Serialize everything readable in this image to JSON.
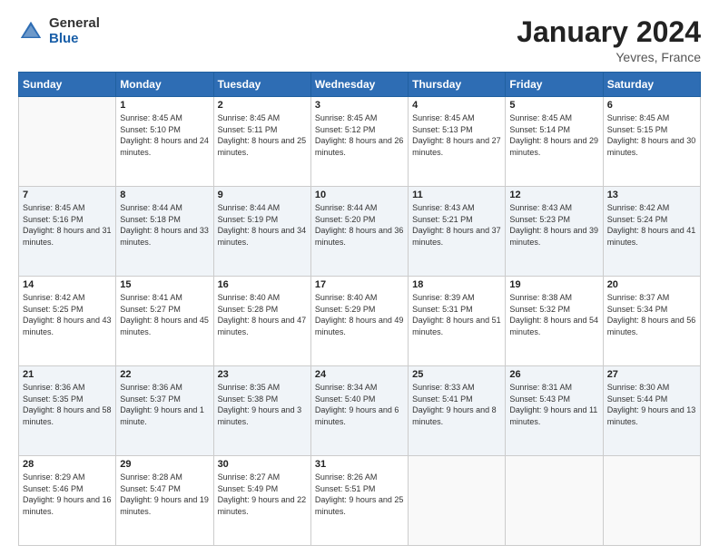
{
  "header": {
    "logo_general": "General",
    "logo_blue": "Blue",
    "month_title": "January 2024",
    "location": "Yevres, France"
  },
  "days_of_week": [
    "Sunday",
    "Monday",
    "Tuesday",
    "Wednesday",
    "Thursday",
    "Friday",
    "Saturday"
  ],
  "weeks": [
    [
      {
        "day": "",
        "sunrise": "",
        "sunset": "",
        "daylight": ""
      },
      {
        "day": "1",
        "sunrise": "Sunrise: 8:45 AM",
        "sunset": "Sunset: 5:10 PM",
        "daylight": "Daylight: 8 hours and 24 minutes."
      },
      {
        "day": "2",
        "sunrise": "Sunrise: 8:45 AM",
        "sunset": "Sunset: 5:11 PM",
        "daylight": "Daylight: 8 hours and 25 minutes."
      },
      {
        "day": "3",
        "sunrise": "Sunrise: 8:45 AM",
        "sunset": "Sunset: 5:12 PM",
        "daylight": "Daylight: 8 hours and 26 minutes."
      },
      {
        "day": "4",
        "sunrise": "Sunrise: 8:45 AM",
        "sunset": "Sunset: 5:13 PM",
        "daylight": "Daylight: 8 hours and 27 minutes."
      },
      {
        "day": "5",
        "sunrise": "Sunrise: 8:45 AM",
        "sunset": "Sunset: 5:14 PM",
        "daylight": "Daylight: 8 hours and 29 minutes."
      },
      {
        "day": "6",
        "sunrise": "Sunrise: 8:45 AM",
        "sunset": "Sunset: 5:15 PM",
        "daylight": "Daylight: 8 hours and 30 minutes."
      }
    ],
    [
      {
        "day": "7",
        "sunrise": "Sunrise: 8:45 AM",
        "sunset": "Sunset: 5:16 PM",
        "daylight": "Daylight: 8 hours and 31 minutes."
      },
      {
        "day": "8",
        "sunrise": "Sunrise: 8:44 AM",
        "sunset": "Sunset: 5:18 PM",
        "daylight": "Daylight: 8 hours and 33 minutes."
      },
      {
        "day": "9",
        "sunrise": "Sunrise: 8:44 AM",
        "sunset": "Sunset: 5:19 PM",
        "daylight": "Daylight: 8 hours and 34 minutes."
      },
      {
        "day": "10",
        "sunrise": "Sunrise: 8:44 AM",
        "sunset": "Sunset: 5:20 PM",
        "daylight": "Daylight: 8 hours and 36 minutes."
      },
      {
        "day": "11",
        "sunrise": "Sunrise: 8:43 AM",
        "sunset": "Sunset: 5:21 PM",
        "daylight": "Daylight: 8 hours and 37 minutes."
      },
      {
        "day": "12",
        "sunrise": "Sunrise: 8:43 AM",
        "sunset": "Sunset: 5:23 PM",
        "daylight": "Daylight: 8 hours and 39 minutes."
      },
      {
        "day": "13",
        "sunrise": "Sunrise: 8:42 AM",
        "sunset": "Sunset: 5:24 PM",
        "daylight": "Daylight: 8 hours and 41 minutes."
      }
    ],
    [
      {
        "day": "14",
        "sunrise": "Sunrise: 8:42 AM",
        "sunset": "Sunset: 5:25 PM",
        "daylight": "Daylight: 8 hours and 43 minutes."
      },
      {
        "day": "15",
        "sunrise": "Sunrise: 8:41 AM",
        "sunset": "Sunset: 5:27 PM",
        "daylight": "Daylight: 8 hours and 45 minutes."
      },
      {
        "day": "16",
        "sunrise": "Sunrise: 8:40 AM",
        "sunset": "Sunset: 5:28 PM",
        "daylight": "Daylight: 8 hours and 47 minutes."
      },
      {
        "day": "17",
        "sunrise": "Sunrise: 8:40 AM",
        "sunset": "Sunset: 5:29 PM",
        "daylight": "Daylight: 8 hours and 49 minutes."
      },
      {
        "day": "18",
        "sunrise": "Sunrise: 8:39 AM",
        "sunset": "Sunset: 5:31 PM",
        "daylight": "Daylight: 8 hours and 51 minutes."
      },
      {
        "day": "19",
        "sunrise": "Sunrise: 8:38 AM",
        "sunset": "Sunset: 5:32 PM",
        "daylight": "Daylight: 8 hours and 54 minutes."
      },
      {
        "day": "20",
        "sunrise": "Sunrise: 8:37 AM",
        "sunset": "Sunset: 5:34 PM",
        "daylight": "Daylight: 8 hours and 56 minutes."
      }
    ],
    [
      {
        "day": "21",
        "sunrise": "Sunrise: 8:36 AM",
        "sunset": "Sunset: 5:35 PM",
        "daylight": "Daylight: 8 hours and 58 minutes."
      },
      {
        "day": "22",
        "sunrise": "Sunrise: 8:36 AM",
        "sunset": "Sunset: 5:37 PM",
        "daylight": "Daylight: 9 hours and 1 minute."
      },
      {
        "day": "23",
        "sunrise": "Sunrise: 8:35 AM",
        "sunset": "Sunset: 5:38 PM",
        "daylight": "Daylight: 9 hours and 3 minutes."
      },
      {
        "day": "24",
        "sunrise": "Sunrise: 8:34 AM",
        "sunset": "Sunset: 5:40 PM",
        "daylight": "Daylight: 9 hours and 6 minutes."
      },
      {
        "day": "25",
        "sunrise": "Sunrise: 8:33 AM",
        "sunset": "Sunset: 5:41 PM",
        "daylight": "Daylight: 9 hours and 8 minutes."
      },
      {
        "day": "26",
        "sunrise": "Sunrise: 8:31 AM",
        "sunset": "Sunset: 5:43 PM",
        "daylight": "Daylight: 9 hours and 11 minutes."
      },
      {
        "day": "27",
        "sunrise": "Sunrise: 8:30 AM",
        "sunset": "Sunset: 5:44 PM",
        "daylight": "Daylight: 9 hours and 13 minutes."
      }
    ],
    [
      {
        "day": "28",
        "sunrise": "Sunrise: 8:29 AM",
        "sunset": "Sunset: 5:46 PM",
        "daylight": "Daylight: 9 hours and 16 minutes."
      },
      {
        "day": "29",
        "sunrise": "Sunrise: 8:28 AM",
        "sunset": "Sunset: 5:47 PM",
        "daylight": "Daylight: 9 hours and 19 minutes."
      },
      {
        "day": "30",
        "sunrise": "Sunrise: 8:27 AM",
        "sunset": "Sunset: 5:49 PM",
        "daylight": "Daylight: 9 hours and 22 minutes."
      },
      {
        "day": "31",
        "sunrise": "Sunrise: 8:26 AM",
        "sunset": "Sunset: 5:51 PM",
        "daylight": "Daylight: 9 hours and 25 minutes."
      },
      {
        "day": "",
        "sunrise": "",
        "sunset": "",
        "daylight": ""
      },
      {
        "day": "",
        "sunrise": "",
        "sunset": "",
        "daylight": ""
      },
      {
        "day": "",
        "sunrise": "",
        "sunset": "",
        "daylight": ""
      }
    ]
  ]
}
